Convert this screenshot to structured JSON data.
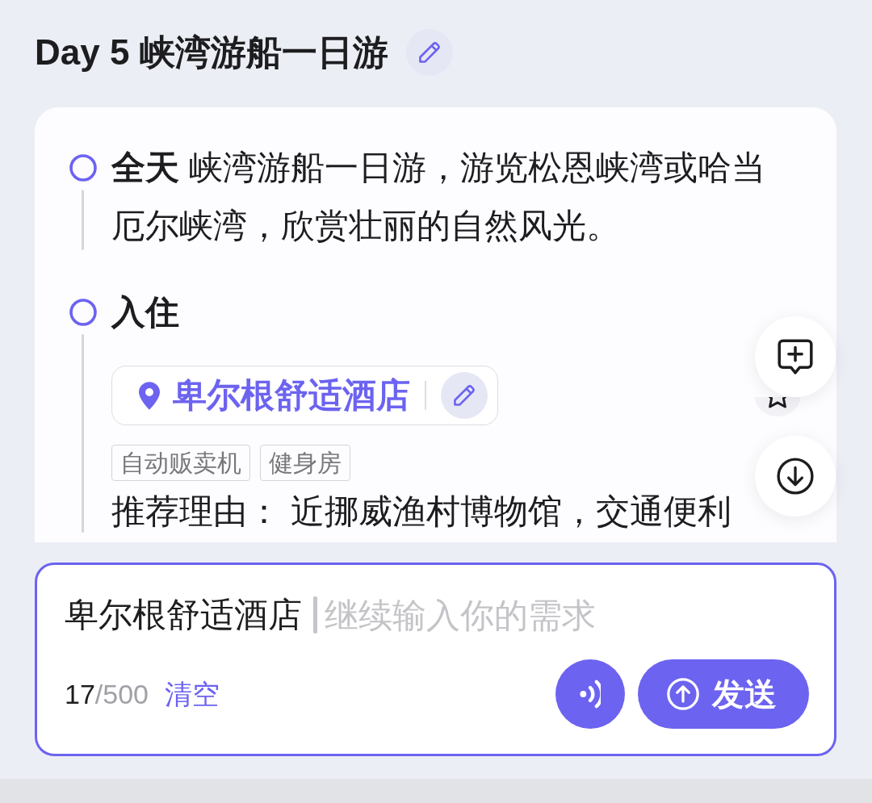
{
  "title": "Day 5 峡湾游船一日游",
  "itinerary": [
    {
      "kind": "activity",
      "text": "**全天** 峡湾游船一日游，游览松恩峡湾或哈当厄尔峡湾，欣赏壮丽的自然风光。"
    },
    {
      "kind": "stay",
      "heading": "入住",
      "hotel": {
        "name": "卑尔根舒适酒店"
      },
      "tags": [
        "自动贩卖机",
        "健身房"
      ],
      "reason": "推荐理由：  近挪威渔村博物馆，交通便利"
    }
  ],
  "composer": {
    "reference_text": "卑尔根舒适酒店",
    "placeholder": "继续输入你的需求",
    "count": "17",
    "limit": "/500",
    "clear_label": "清空",
    "send_label": "发送"
  }
}
